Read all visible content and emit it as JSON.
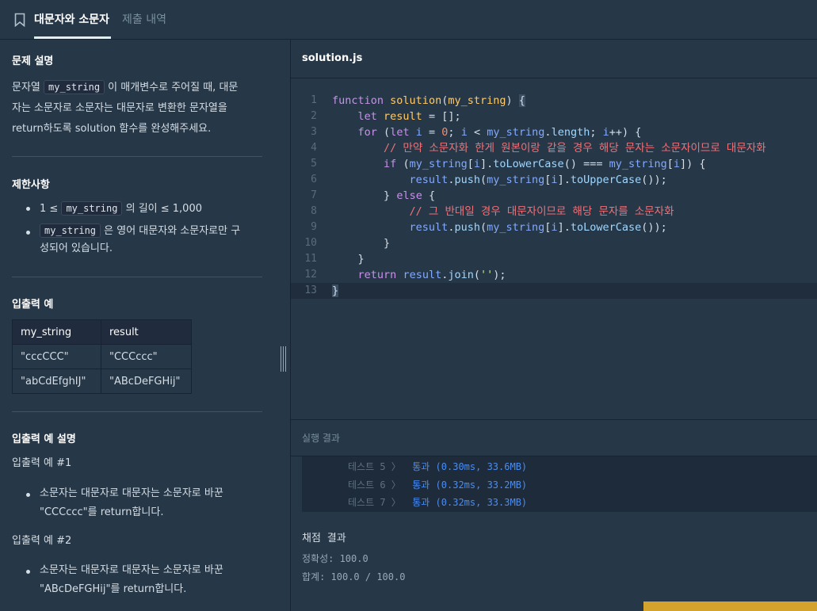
{
  "header": {
    "active_tab": "대문자와 소문자",
    "inactive_tab": "제출 내역"
  },
  "problem": {
    "desc_title": "문제 설명",
    "desc_part1": "문자열 ",
    "desc_code": "my_string",
    "desc_part2": " 이 매개변수로 주어질 때, 대문",
    "desc_line2": "자는 소문자로 소문자는 대문자로 변환한 문자열을",
    "desc_line3": "return하도록 solution 함수를 완성해주세요.",
    "constraints_title": "제한사항",
    "c1_pre": "1 ≤ ",
    "c1_code": "my_string",
    "c1_post": " 의 길이 ≤ 1,000",
    "c2_code": "my_string",
    "c2_post": " 은 영어 대문자와 소문자로만 구",
    "c2_line2": "성되어 있습니다.",
    "io_title": "입출력 예",
    "io_headers": [
      "my_string",
      "result"
    ],
    "io_rows": [
      [
        "\"cccCCC\"",
        "\"CCCccc\""
      ],
      [
        "\"abCdEfghIJ\"",
        "\"ABcDeFGHij\""
      ]
    ],
    "io_desc_title": "입출력 예 설명",
    "ex1_title": "입출력 예 #1",
    "ex1_line1": "소문자는 대문자로 대문자는 소문자로 바꾼",
    "ex1_line2": "\"CCCccc\"를 return합니다.",
    "ex2_title": "입출력 예 #2",
    "ex2_line1": "소문자는 대문자로 대문자는 소문자로 바꾼",
    "ex2_line2": "\"ABcDeFGHij\"를 return합니다."
  },
  "editor": {
    "filename": "solution.js",
    "line_numbers": [
      "1",
      "2",
      "3",
      "4",
      "5",
      "6",
      "7",
      "8",
      "9",
      "10",
      "11",
      "12",
      "13"
    ]
  },
  "results": {
    "title": "실행 결과",
    "rows": [
      {
        "label": "테스트 5 〉",
        "value": "통과 (0.30ms, 33.6MB)"
      },
      {
        "label": "테스트 6 〉",
        "value": "통과 (0.32ms, 33.2MB)"
      },
      {
        "label": "테스트 7 〉",
        "value": "통과 (0.32ms, 33.3MB)"
      }
    ],
    "grade_title": "채점 결과",
    "accuracy": "정확성: 100.0",
    "total": "합계: 100.0 / 100.0"
  },
  "icons": {
    "bookmark": "bookmark-icon",
    "splitter": "drag-handle-icon"
  },
  "colors": {
    "background": "#263747",
    "accent_submit": "#d4a32c",
    "pass": "#4a8cf0"
  }
}
